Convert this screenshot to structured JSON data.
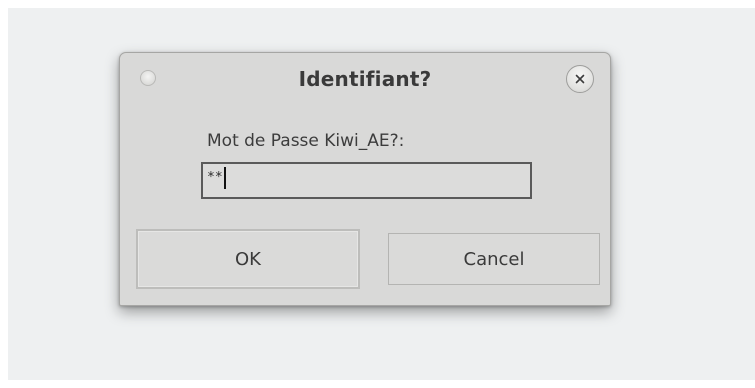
{
  "dialog": {
    "title": "Identifiant?",
    "prompt": "Mot de Passe Kiwi_AE?:",
    "password_value": "**",
    "ok_label": "OK",
    "cancel_label": "Cancel",
    "close_icon": "close-icon",
    "window_icon": "window-menu-icon"
  },
  "colors": {
    "dialog_bg": "#d9d9d8",
    "backdrop": "#eef0f1",
    "text": "#3a3a3a"
  }
}
